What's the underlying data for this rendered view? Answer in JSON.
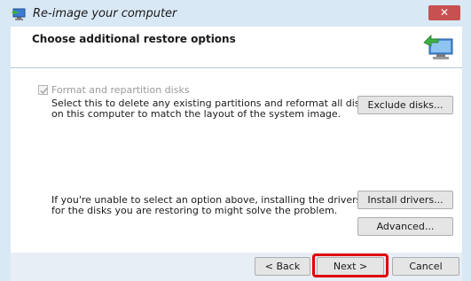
{
  "window": {
    "title": "Re-image your computer",
    "close_glyph": "✕"
  },
  "header": {
    "heading": "Choose additional restore options",
    "illustration_icon": "restore-computer-icon"
  },
  "format_option": {
    "checkbox_label": "Format and repartition disks",
    "checked": true,
    "enabled": false,
    "description_line1": "Select this to delete any existing partitions and reformat all disks",
    "description_line2": "on this computer to match the layout of the system image.",
    "exclude_button": "Exclude disks..."
  },
  "drivers": {
    "description_line1": "If you're unable to select an option above, installing the drivers",
    "description_line2": "for the disks you are restoring to might solve the problem.",
    "install_button": "Install drivers...",
    "advanced_button": "Advanced..."
  },
  "footer": {
    "back_button": "< Back",
    "next_button": "Next >",
    "cancel_button": "Cancel"
  },
  "colors": {
    "highlight": "#e00000",
    "close_button": "#c75050",
    "frame": "#d9e8f5"
  }
}
